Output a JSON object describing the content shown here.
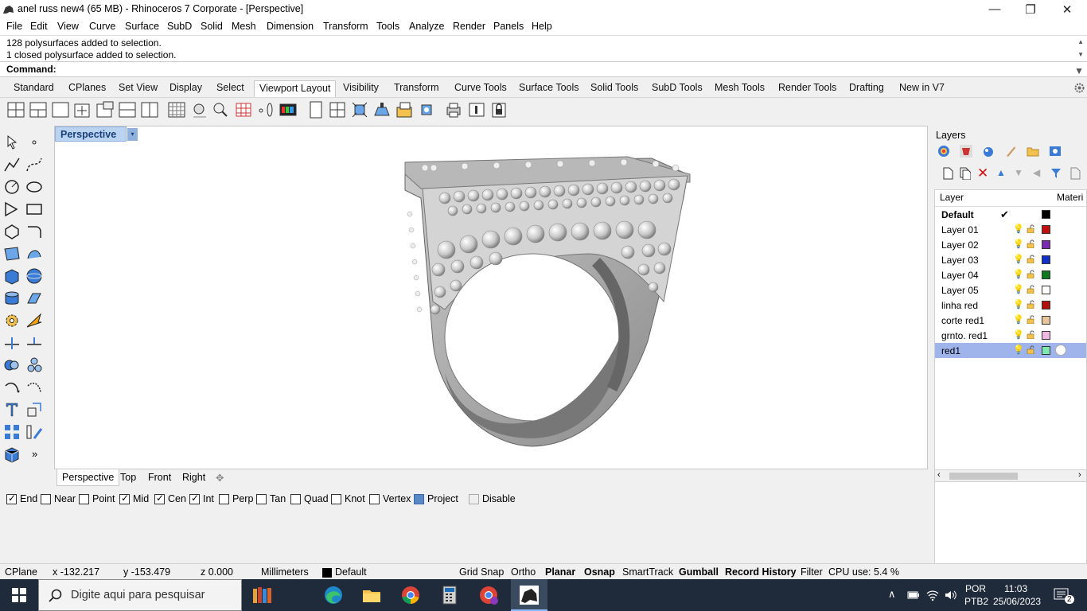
{
  "window": {
    "title": "anel russ new4 (65 MB) - Rhinoceros 7 Corporate - [Perspective]",
    "minimize": "—",
    "maximize": "❐",
    "close": "✕"
  },
  "menu": [
    "File",
    "Edit",
    "View",
    "Curve",
    "Surface",
    "SubD",
    "Solid",
    "Mesh",
    "Dimension",
    "Transform",
    "Tools",
    "Analyze",
    "Render",
    "Panels",
    "Help"
  ],
  "command": {
    "history": [
      "128 polysurfaces added to selection.",
      "1 closed polysurface added to selection."
    ],
    "prompt": "Command:"
  },
  "tabs": [
    "Standard",
    "CPlanes",
    "Set View",
    "Display",
    "Select",
    "Viewport Layout",
    "Visibility",
    "Transform",
    "Curve Tools",
    "Surface Tools",
    "Solid Tools",
    "SubD Tools",
    "Mesh Tools",
    "Render Tools",
    "Drafting",
    "New in V7"
  ],
  "active_tab": "Viewport Layout",
  "viewport": {
    "label": "Perspective",
    "dropdown": "▾"
  },
  "view_tabs": [
    "Perspective",
    "Top",
    "Front",
    "Right"
  ],
  "view_add": "✥",
  "layers_panel": {
    "title": "Layers",
    "col_layer": "Layer",
    "col_material": "Materi",
    "rows": [
      {
        "name": "Default",
        "color": "#000000",
        "current": true
      },
      {
        "name": "Layer 01",
        "color": "#c01010"
      },
      {
        "name": "Layer 02",
        "color": "#7a2cb0"
      },
      {
        "name": "Layer 03",
        "color": "#1030c8"
      },
      {
        "name": "Layer 04",
        "color": "#107a20"
      },
      {
        "name": "Layer 05",
        "color": "#ffffff"
      },
      {
        "name": "linha red",
        "color": "#b01010"
      },
      {
        "name": "corte red1",
        "color": "#e8c49a"
      },
      {
        "name": "grnto. red1",
        "color": "#f0b8e0"
      },
      {
        "name": "red1",
        "color": "#7ee8b0",
        "selected": true
      }
    ]
  },
  "osnap": [
    {
      "label": "End",
      "checked": true
    },
    {
      "label": "Near",
      "checked": false
    },
    {
      "label": "Point",
      "checked": false
    },
    {
      "label": "Mid",
      "checked": true
    },
    {
      "label": "Cen",
      "checked": true
    },
    {
      "label": "Int",
      "checked": true
    },
    {
      "label": "Perp",
      "checked": false
    },
    {
      "label": "Tan",
      "checked": false
    },
    {
      "label": "Quad",
      "checked": false
    },
    {
      "label": "Knot",
      "checked": false
    },
    {
      "label": "Vertex",
      "checked": false
    },
    {
      "label": "Project",
      "checked": false
    },
    {
      "label": "Disable",
      "checked": false
    }
  ],
  "status": {
    "cplane": "CPlane",
    "x": "x -132.217",
    "y": "y -153.479",
    "z": "z 0.000",
    "units": "Millimeters",
    "layer": "Default",
    "grid_snap": "Grid Snap",
    "ortho": "Ortho",
    "planar": "Planar",
    "osnap": "Osnap",
    "smarttrack": "SmartTrack",
    "gumball": "Gumball",
    "record_history": "Record History",
    "filter": "Filter",
    "cpu": "CPU use: 5.4 %"
  },
  "taskbar": {
    "search_placeholder": "Digite aqui para pesquisar",
    "lang1": "POR",
    "lang2": "PTB2",
    "time": "11:03",
    "date": "25/06/2023",
    "notifications": "2"
  }
}
